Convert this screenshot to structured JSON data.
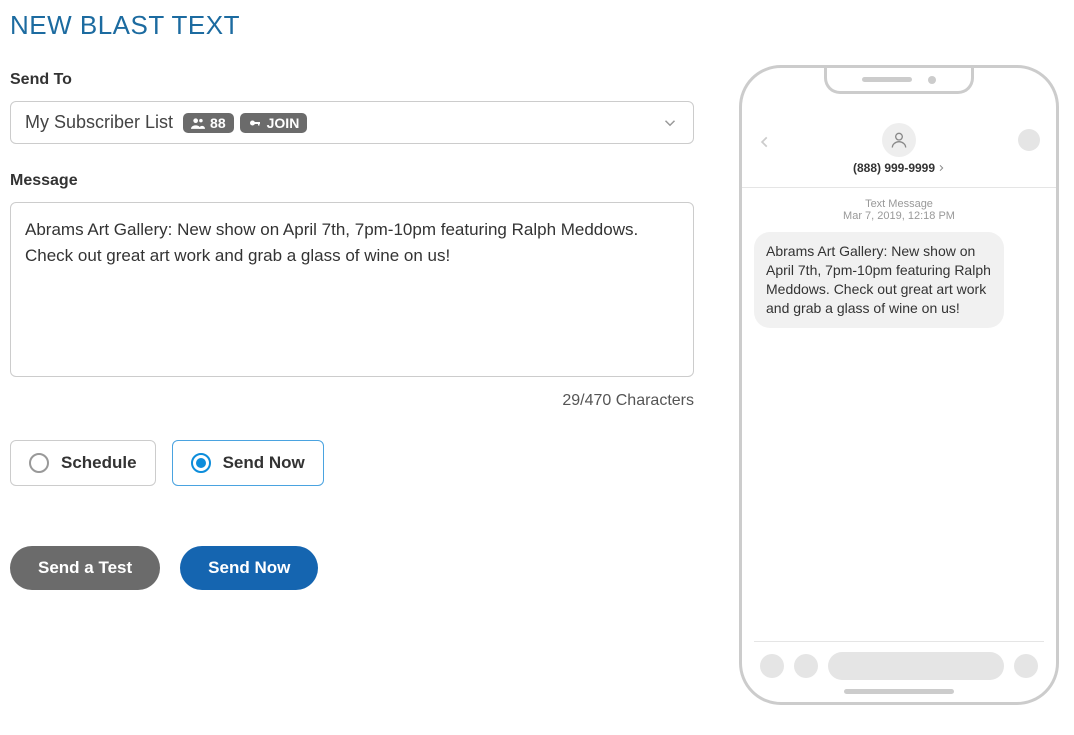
{
  "page_title": "NEW BLAST TEXT",
  "send_to": {
    "label": "Send To",
    "selected_list_name": "My Subscriber List",
    "subscriber_count": "88",
    "keyword": "JOIN"
  },
  "message": {
    "label": "Message",
    "value": "Abrams Art Gallery: New show on April 7th, 7pm-10pm featuring Ralph Meddows. Check out great art work and grab a glass of wine on us!",
    "character_counter": "29/470 Characters"
  },
  "timing": {
    "options": [
      {
        "label": "Schedule",
        "selected": false
      },
      {
        "label": "Send Now",
        "selected": true
      }
    ]
  },
  "actions": {
    "test_label": "Send a Test",
    "send_label": "Send Now"
  },
  "preview": {
    "phone_number": "(888) 999-9999",
    "meta_line1": "Text Message",
    "meta_line2": "Mar 7, 2019, 12:18 PM",
    "bubble_text": "Abrams Art Gallery: New show on April 7th, 7pm-10pm featuring Ralph Meddows. Check out great art work and grab a glass of wine on us!"
  }
}
